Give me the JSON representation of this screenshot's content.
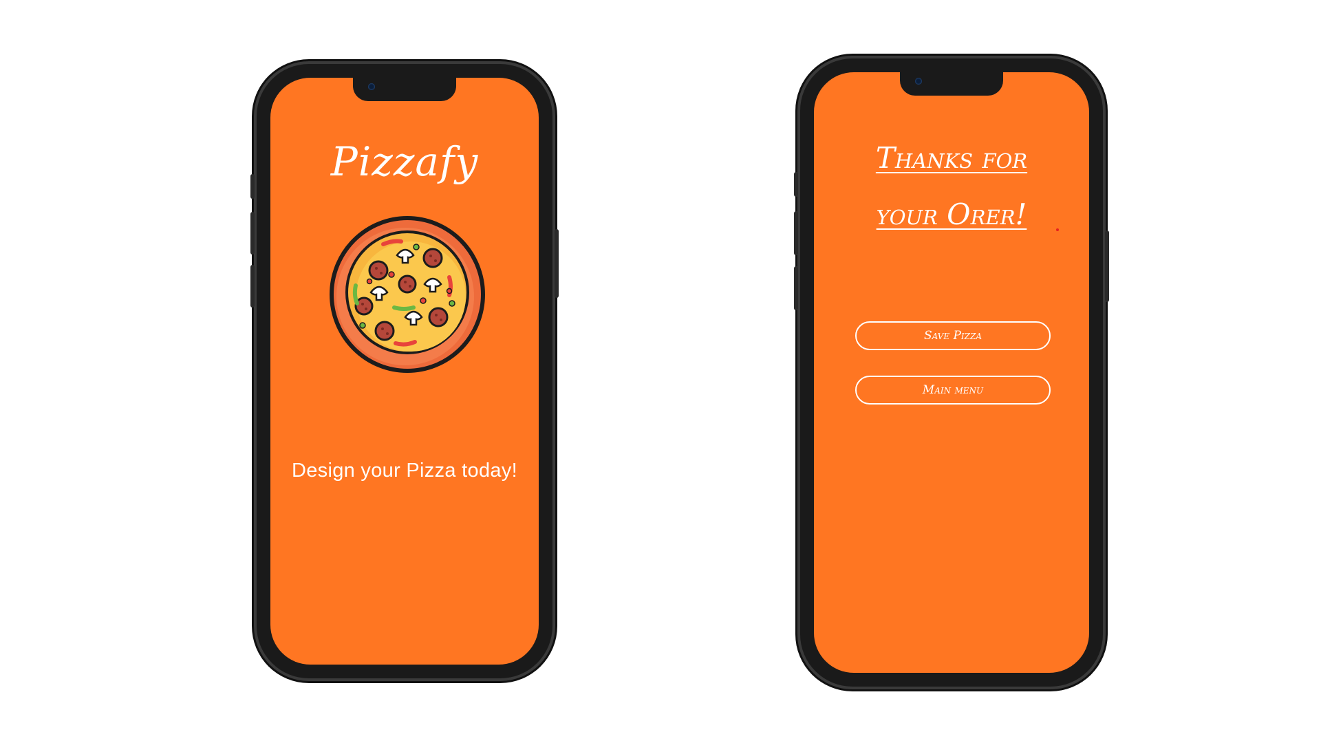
{
  "colors": {
    "screen_background": "#ff7622",
    "frame": "#1a1a1a",
    "text": "#ffffff"
  },
  "left_screen": {
    "app_title": "Pizzafy",
    "pizza_icon": "pizza-icon",
    "tagline": "Design your Pizza today!"
  },
  "right_screen": {
    "thanks_line1": "Thanks for",
    "thanks_line2": "your Orer!",
    "save_pizza_label": "Save Pizza",
    "main_menu_label": "Main menu"
  }
}
